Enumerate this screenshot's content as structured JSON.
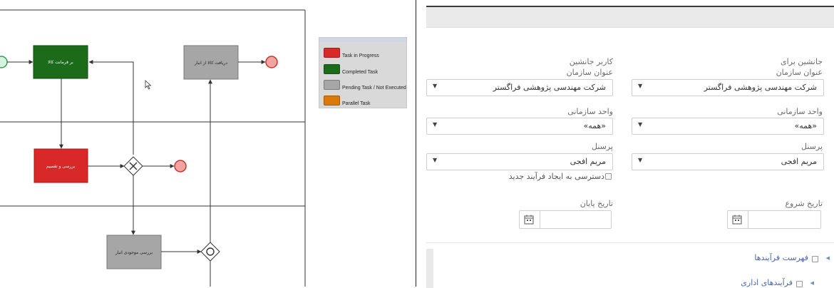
{
  "legend": {
    "items": [
      {
        "label": "Task in Progress",
        "color": "#d92828"
      },
      {
        "label": "Completed Task",
        "color": "#1b6b1b"
      },
      {
        "label": "Pending Task / Not Executed",
        "color": "#a6a6a6"
      },
      {
        "label": "Parallel Task",
        "color": "#d97a0a"
      }
    ]
  },
  "diagram": {
    "tasks": {
      "green_task": {
        "label": "بر فرمانت کالا",
        "color": "#1b6b1b"
      },
      "gray_task_top": {
        "label": "دریافت کالا از انبار",
        "color": "#a6a6a6"
      },
      "red_task": {
        "label": "بررسی و تقسیم",
        "color": "#d92828"
      },
      "gray_task_bottom": {
        "label": "بررسی موجودی انبار",
        "color": "#a6a6a6"
      }
    },
    "colors": {
      "event_fill": "#f4a3a3",
      "event_stroke": "#c0392b",
      "start_stroke": "#3a9a5a",
      "line": "#333333"
    }
  },
  "form": {
    "successor_user_label": "کاربر جانشین",
    "substitute_for_label": "جانشین برای",
    "org_title_label": "عنوان سازمان",
    "org_title_label_right": "عنوان سازمان",
    "org_value_left": "شرکت مهندسی پژوهشی فراگستر",
    "org_value_right": "شرکت مهندسی پژوهشی فراگستر",
    "org_unit_label_left": "واحد سازمانی",
    "org_unit_label_right": "واحد سازمانی",
    "org_unit_value_left": "«همه»",
    "org_unit_value_right": "«همه»",
    "personnel_label_left": "پرسنل",
    "personnel_label_right": "پرسنل",
    "personnel_value_left": "مریم افجی",
    "personnel_value_right": "مریم افجی",
    "new_process_access_label": "دسترسی به ایجاد فرآیند جدید",
    "end_date_label": "تاریخ پایان",
    "start_date_label": "تاریخ شروع"
  },
  "tree": {
    "items": [
      {
        "label": "فهرست فرآیندها"
      },
      {
        "label": "فرآیندهای اداری"
      }
    ]
  }
}
